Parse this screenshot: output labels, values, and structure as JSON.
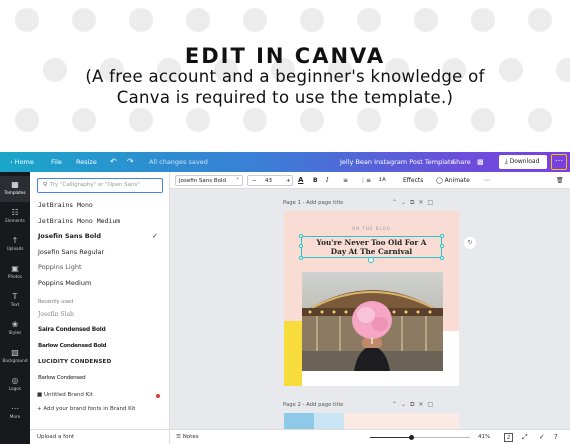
{
  "banner": {
    "title": "EDIT IN CANVA",
    "subtitle": "(A free account and a beginner's knowledge of Canva is required to use the template.)"
  },
  "topbar": {
    "home": "Home",
    "file": "File",
    "resize": "Resize",
    "undo_icon": "undo-icon",
    "redo_icon": "redo-icon",
    "saved_status": "All changes saved",
    "doc_title": "Jelly Bean Instagram Post Template",
    "share": "Share",
    "download": "Download",
    "more": "⋯"
  },
  "rail": {
    "items": [
      {
        "label": "Templates",
        "icon": "▦"
      },
      {
        "label": "Elements",
        "icon": "☷"
      },
      {
        "label": "Uploads",
        "icon": "↑"
      },
      {
        "label": "Photos",
        "icon": "▣"
      },
      {
        "label": "Text",
        "icon": "T"
      },
      {
        "label": "Styles",
        "icon": "❀"
      },
      {
        "label": "Background",
        "icon": "▧"
      },
      {
        "label": "Logos",
        "icon": "◎"
      },
      {
        "label": "More",
        "icon": "⋯"
      }
    ]
  },
  "fontpanel": {
    "search_placeholder": "Try \"Calligraphy\" or \"Open Sans\"",
    "fonts": [
      {
        "name": "JetBrains Mono",
        "style": "mono"
      },
      {
        "name": "JetBrains Mono Medium",
        "style": "mono"
      },
      {
        "name": "Josefin Sans Bold",
        "style": "bold",
        "selected": true
      },
      {
        "name": "Josefin Sans Regular",
        "style": "regular"
      },
      {
        "name": "Poppins Light",
        "style": "light"
      },
      {
        "name": "Poppins Medium",
        "style": "medium"
      }
    ],
    "recently_used_label": "Recently used",
    "recent": [
      {
        "name": "Josefin Slab",
        "style": "slab"
      },
      {
        "name": "Saira Condensed Bold",
        "style": "condbold"
      },
      {
        "name": "Barlow Condensed Bold",
        "style": "condbold2"
      },
      {
        "name": "LUCIDITY CONDENSED",
        "style": "caps"
      },
      {
        "name": "Barlow Condensed",
        "style": "cond"
      }
    ],
    "brand_kit": "Untitled Brand Kit",
    "add_brand_fonts": "Add your brand fonts in Brand Kit",
    "upload_font": "Upload a font"
  },
  "toolbar": {
    "font_family": "Josefin Sans Bold",
    "font_size": "43",
    "effects": "Effects",
    "animate": "Animate"
  },
  "canvas": {
    "page1_label": "Page 1 - Add page title",
    "page2_label": "Page 2 - Add page title",
    "on_the_blog": "ON THE BLOG",
    "headline_line1": "You're Never Too Old For A",
    "headline_line2": "Day At The Carnival"
  },
  "bottombar": {
    "notes": "Notes",
    "zoom": "41%",
    "zoom_fraction": 0.41,
    "page_count": "2"
  },
  "colors": {
    "topbar_start": "#19a6c9",
    "topbar_end": "#7b3fe0",
    "page_bg": "#f9ddd5",
    "accent_yellow": "#f7dc3c",
    "selection": "#2dc2c9"
  }
}
